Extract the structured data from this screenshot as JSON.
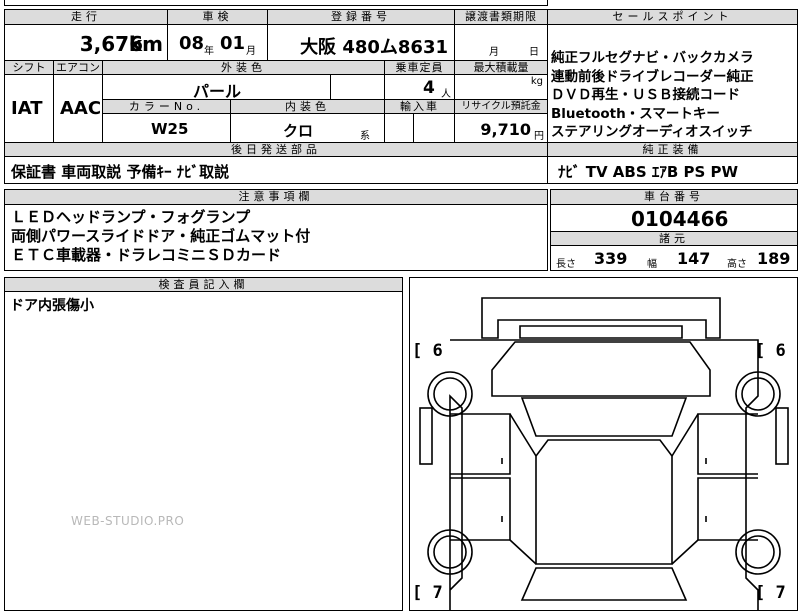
{
  "headers": {
    "mileage": "走行",
    "inspection": "車検",
    "registration": "登録番号",
    "transfer_deadline": "譲渡書類期限",
    "sales_points": "セールスポイント",
    "shift": "シフト",
    "aircon": "エアコン",
    "exterior_color": "外装色",
    "capacity": "乗車定員",
    "max_load": "最大積載量",
    "color_no": "カラーNo.",
    "interior_color": "内装色",
    "import": "輸入車",
    "recycle_fee": "リサイクル預託金",
    "deferred_parts": "後日発送部品",
    "options": "純正装備",
    "caution": "注意事項欄",
    "chassis_no": "車台番号",
    "specs": "諸元",
    "inspector_notes": "検査員記入欄"
  },
  "values": {
    "mileage": "3,676",
    "mileage_unit": "km",
    "inspection_year": "08",
    "inspection_year_unit": "年",
    "inspection_month": "01",
    "inspection_month_unit": "月",
    "plate": "大阪 480ム8631",
    "deadline_month_unit": "月",
    "deadline_day_unit": "日",
    "shift": "IAT",
    "aircon": "AAC",
    "exterior_color": "パール",
    "capacity": "4",
    "capacity_unit": "人",
    "max_load_unit": "kg",
    "color_no": "W25",
    "interior_color": "クロ",
    "interior_color_unit": "系",
    "recycle_fee": "9,710",
    "recycle_fee_unit": "円",
    "chassis_no": "0104466"
  },
  "sales_points": [
    "純正フルセグナビ・バックカメラ",
    "連動前後ドライブレコーダー純正",
    "ＤＶＤ再生・ＵＳＢ接続コード",
    "Bluetooth・スマートキー",
    "ステアリングオーディオスイッチ"
  ],
  "deferred_parts": "保証書 車両取説 予備ｷｰ ﾅﾋﾞ取説",
  "options": "ﾅﾋﾞ TV ABS ｴｱB PS PW",
  "cautions": [
    "ＬＥＤヘッドランプ・フォグランプ",
    "両側パワースライドドア・純正ゴムマット付",
    "ＥＴＣ車載器・ドラレコミニＳＤカード"
  ],
  "specs": {
    "length_label": "長さ",
    "length": "339",
    "width_label": "幅",
    "width": "147",
    "height_label": "高さ",
    "height": "189"
  },
  "inspector_notes": "ドア内張傷小",
  "diagram": {
    "tire_front_left": "[ 6",
    "tire_front_right": "[ 6",
    "tire_rear_left": "[ 7",
    "tire_rear_right": "[ 7"
  },
  "watermark": "WEB-STUDIO.PRO"
}
